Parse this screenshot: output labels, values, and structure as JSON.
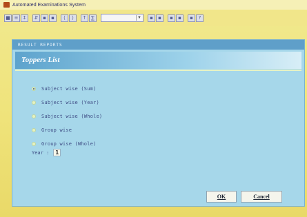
{
  "window": {
    "title": "Automated Examinations System"
  },
  "toolbar": {
    "buttons": [
      "■",
      "≡",
      "↕",
      "⇵",
      "▪",
      "▪",
      "⟨",
      "⟩",
      "↑",
      "∑",
      "▪",
      "▪",
      "▪",
      "▪",
      "▪",
      "?"
    ],
    "combo_value": ""
  },
  "panel": {
    "header": "RESULT REPORTS",
    "title": "Toppers List",
    "options": [
      {
        "label": "Subject wise (Sum)",
        "checked": true
      },
      {
        "label": "Subject wise (Year)",
        "checked": false
      },
      {
        "label": "Subject wise (Whole)",
        "checked": false
      },
      {
        "label": "Group wise",
        "checked": false
      },
      {
        "label": "Group wise (Whole)",
        "checked": false
      }
    ],
    "year_label": "Year :",
    "year_value": "1",
    "ok_label": "OK",
    "cancel_label": "Cancel"
  }
}
